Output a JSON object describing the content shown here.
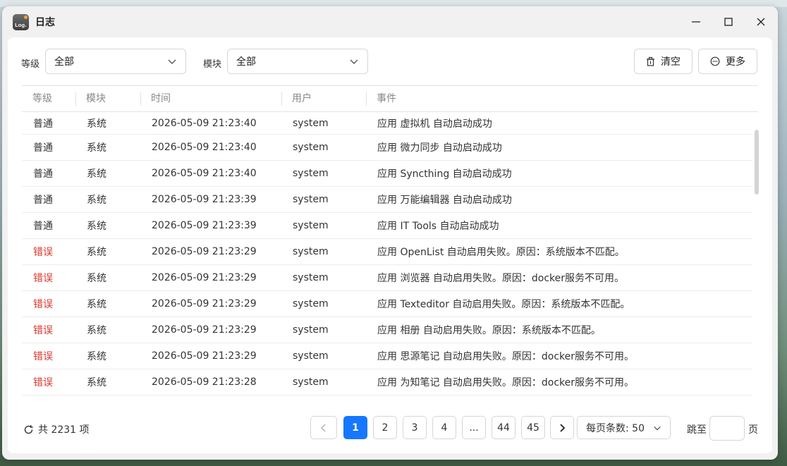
{
  "window": {
    "title": "日志",
    "app_icon_text": "Log."
  },
  "filters": {
    "level_label": "等级",
    "level_value": "全部",
    "module_label": "模块",
    "module_value": "全部"
  },
  "actions": {
    "clear_label": "清空",
    "more_label": "更多"
  },
  "table": {
    "columns": [
      "等级",
      "模块",
      "时间",
      "用户",
      "事件"
    ],
    "rows": [
      {
        "level": "普通",
        "module": "系统",
        "time": "2026-05-09 21:23:40",
        "user": "system",
        "event": "应用 虚拟机 自动启动成功",
        "is_error": false
      },
      {
        "level": "普通",
        "module": "系统",
        "time": "2026-05-09 21:23:40",
        "user": "system",
        "event": "应用 微力同步 自动启动成功",
        "is_error": false
      },
      {
        "level": "普通",
        "module": "系统",
        "time": "2026-05-09 21:23:40",
        "user": "system",
        "event": "应用 Syncthing 自动启动成功",
        "is_error": false
      },
      {
        "level": "普通",
        "module": "系统",
        "time": "2026-05-09 21:23:39",
        "user": "system",
        "event": "应用 万能编辑器 自动启动成功",
        "is_error": false
      },
      {
        "level": "普通",
        "module": "系统",
        "time": "2026-05-09 21:23:39",
        "user": "system",
        "event": "应用 IT Tools 自动启动成功",
        "is_error": false
      },
      {
        "level": "错误",
        "module": "系统",
        "time": "2026-05-09 21:23:29",
        "user": "system",
        "event": "应用 OpenList 自动启用失败。原因：系统版本不匹配。",
        "is_error": true
      },
      {
        "level": "错误",
        "module": "系统",
        "time": "2026-05-09 21:23:29",
        "user": "system",
        "event": "应用 浏览器 自动启用失败。原因：docker服务不可用。",
        "is_error": true
      },
      {
        "level": "错误",
        "module": "系统",
        "time": "2026-05-09 21:23:29",
        "user": "system",
        "event": "应用 Texteditor 自动启用失败。原因：系统版本不匹配。",
        "is_error": true
      },
      {
        "level": "错误",
        "module": "系统",
        "time": "2026-05-09 21:23:29",
        "user": "system",
        "event": "应用 相册 自动启用失败。原因：系统版本不匹配。",
        "is_error": true
      },
      {
        "level": "错误",
        "module": "系统",
        "time": "2026-05-09 21:23:29",
        "user": "system",
        "event": "应用 思源笔记 自动启用失败。原因：docker服务不可用。",
        "is_error": true
      },
      {
        "level": "错误",
        "module": "系统",
        "time": "2026-05-09 21:23:28",
        "user": "system",
        "event": "应用 为知笔记 自动启用失败。原因：docker服务不可用。",
        "is_error": true
      }
    ]
  },
  "footer": {
    "total_text": "共 2231 项",
    "pages": [
      "1",
      "2",
      "3",
      "4",
      "...",
      "44",
      "45"
    ],
    "current_page": "1",
    "page_size_text": "每页条数: 50",
    "jump_label": "跳至",
    "jump_suffix": "页"
  },
  "colors": {
    "accent": "#1677ff",
    "error": "#d9362b"
  }
}
